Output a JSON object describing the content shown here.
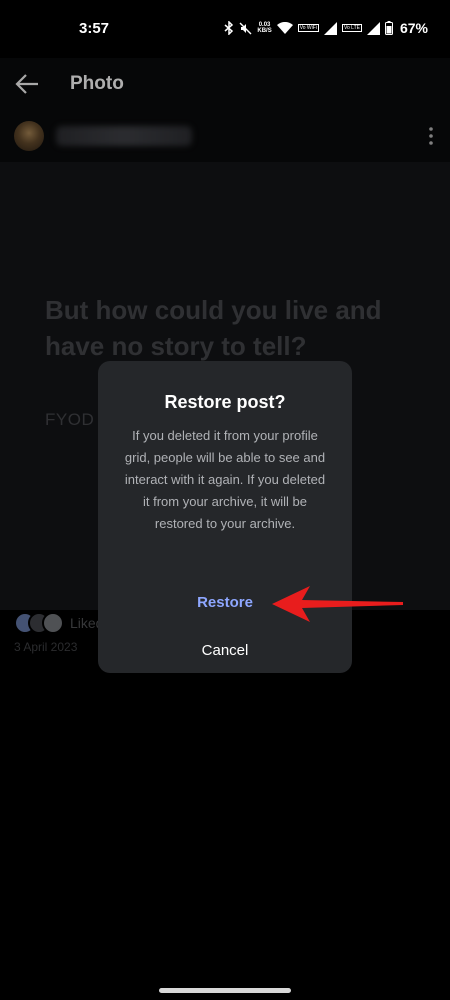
{
  "status_bar": {
    "time": "3:57",
    "net_speed_value": "0.03",
    "net_speed_unit": "KB/S",
    "sim1_label": "Vo WiFi",
    "sim2_label": "Vo LTE",
    "battery": "67%",
    "icons": [
      "bluetooth-icon",
      "mute-icon",
      "wifi-icon",
      "signal-icon",
      "battery-icon"
    ]
  },
  "app_bar": {
    "title": "Photo"
  },
  "post": {
    "quote": "But how could you live and have no story to tell?",
    "author": "FYOD",
    "likes": "Liked",
    "date": "3 April 2023"
  },
  "dialog": {
    "title": "Restore post?",
    "message": "If you deleted it from your profile grid, people will be able to see and interact with it again. If you deleted it from your archive, it will be restored to your archive.",
    "restore_label": "Restore",
    "cancel_label": "Cancel"
  },
  "colors": {
    "background": "#000000",
    "dialog": "#25272a",
    "restore_accent": "#8ea7ff",
    "annotation_arrow": "#e81d1d"
  }
}
